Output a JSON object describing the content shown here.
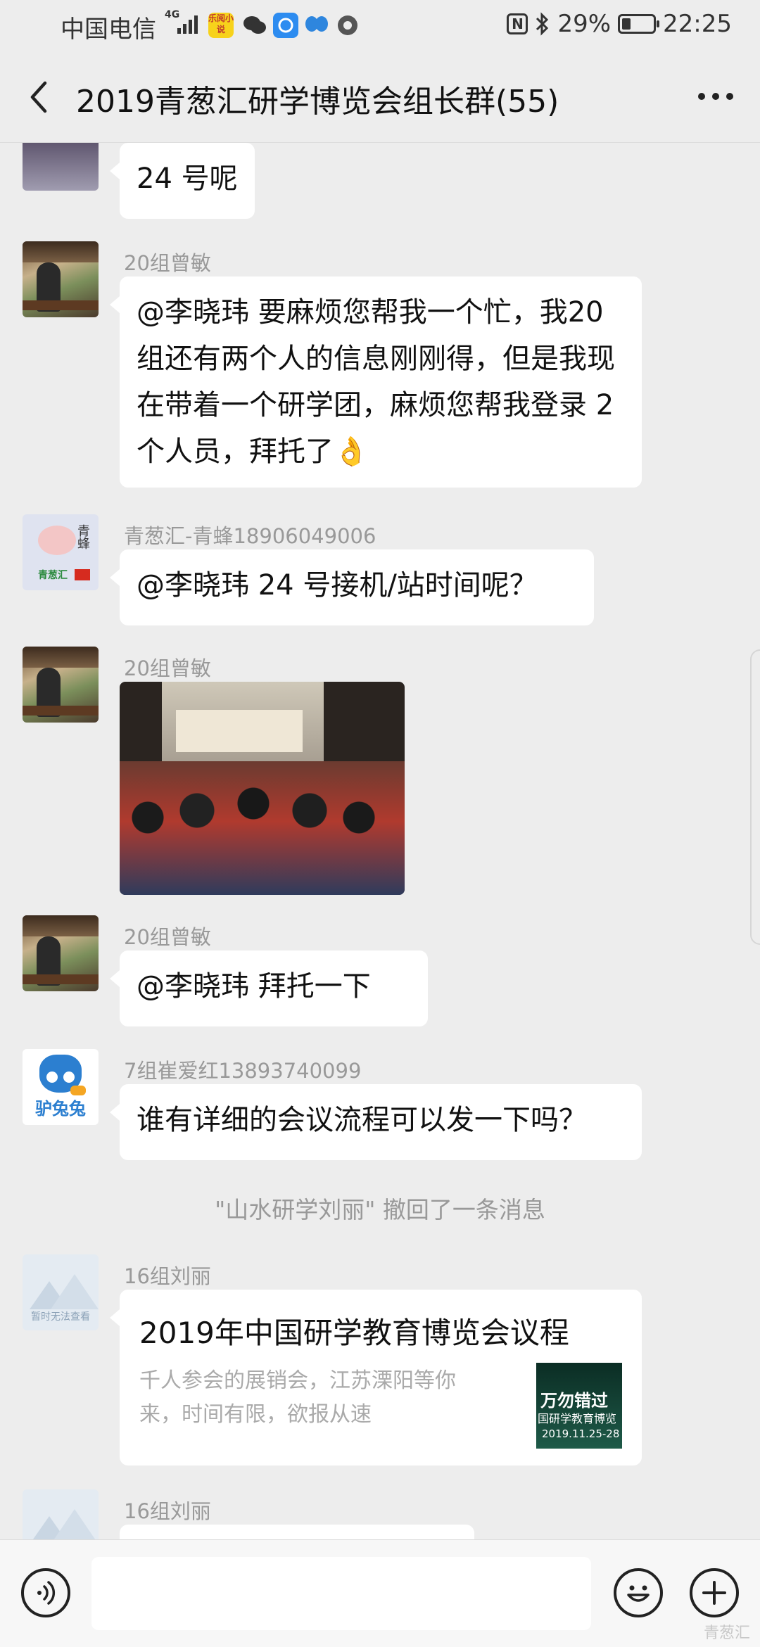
{
  "status_bar": {
    "carrier": "中国电信",
    "network": "4G",
    "battery": "29%",
    "battery_level": 0.29,
    "time": "22:25",
    "app_badge": "乐阅小说"
  },
  "header": {
    "title": "2019青葱汇研学博览会组长群(55)"
  },
  "messages": [
    {
      "sender": "",
      "text": "24 号呢"
    },
    {
      "sender": "20组曾敏",
      "text": "@李晓玮  要麻烦您帮我一个忙，我20 组还有两个人的信息刚刚得，但是我现在带着一个研学团，麻烦您帮我登录 2 个人员，拜托了👌"
    },
    {
      "sender": "青葱汇-青蜂18906049006",
      "text": "@李晓玮  24 号接机/站时间呢？",
      "avatar_text": "青蜂",
      "avatar_logo": "青葱汇"
    },
    {
      "sender": "20组曾敏",
      "type": "image"
    },
    {
      "sender": "20组曾敏",
      "text": "@李晓玮  拜托一下"
    },
    {
      "sender": "7组崔爱红13893740099",
      "text": "谁有详细的会议流程可以发一下吗？",
      "avatar_text": "驴兔兔"
    },
    {
      "sender": "16组刘丽",
      "type": "link",
      "card_title": "2019年中国研学教育博览会议程",
      "card_desc": "千人参会的展销会，江苏溧阳等你来，时间有限，欲报从速",
      "thumb_line1": "万勿错过",
      "thumb_line2": "国研学教育博览",
      "thumb_line3": "2019.11.25-28",
      "avatar_caption": "暂时无法查看"
    },
    {
      "sender": "16组刘丽",
      "type": "partial"
    }
  ],
  "system_notice": "\"山水研学刘丽\" 撤回了一条消息",
  "watermark": "青葱汇"
}
